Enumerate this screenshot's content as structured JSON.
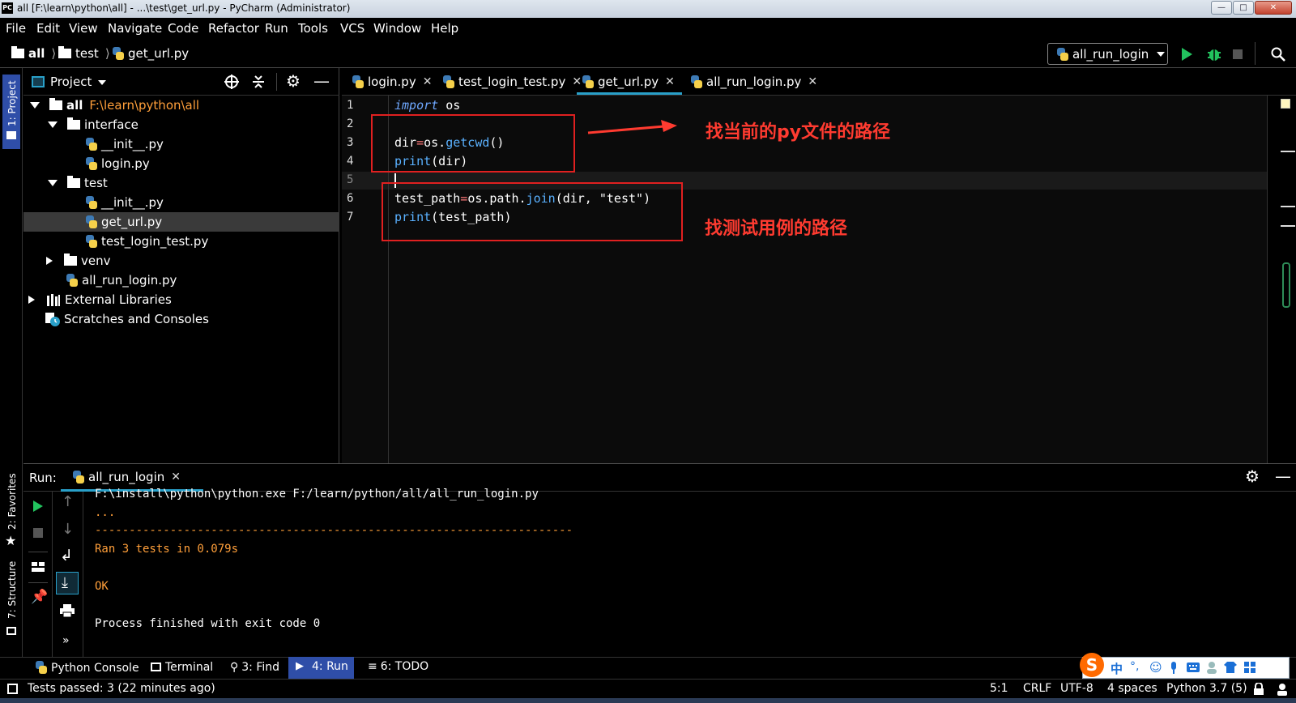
{
  "window": {
    "title": "all [F:\\learn\\python\\all] - ...\\test\\get_url.py - PyCharm (Administrator)",
    "logo": "PC"
  },
  "menu": [
    "File",
    "Edit",
    "View",
    "Navigate",
    "Code",
    "Refactor",
    "Run",
    "Tools",
    "VCS",
    "Window",
    "Help"
  ],
  "breadcrumb": [
    "all",
    "test",
    "get_url.py"
  ],
  "run_config": "all_run_login",
  "left_strip": {
    "project": "1: Project",
    "favorites": "2: Favorites",
    "structure": "7: Structure"
  },
  "project_panel": {
    "title": "Project",
    "tree": [
      {
        "label": "all",
        "extra": "F:\\learn\\python\\all",
        "type": "folder",
        "expanded": true
      },
      {
        "label": "interface",
        "type": "folder",
        "expanded": true
      },
      {
        "label": "__init__.py",
        "type": "py"
      },
      {
        "label": "login.py",
        "type": "py"
      },
      {
        "label": "test",
        "type": "folder",
        "expanded": true
      },
      {
        "label": "__init__.py",
        "type": "py"
      },
      {
        "label": "get_url.py",
        "type": "py",
        "selected": true
      },
      {
        "label": "test_login_test.py",
        "type": "py"
      },
      {
        "label": "venv",
        "type": "folder",
        "expanded": false
      },
      {
        "label": "all_run_login.py",
        "type": "py"
      },
      {
        "label": "External Libraries",
        "type": "lib",
        "expanded": false
      },
      {
        "label": "Scratches and Consoles",
        "type": "scratch"
      }
    ]
  },
  "editor": {
    "tabs": [
      "login.py",
      "test_login_test.py",
      "get_url.py",
      "all_run_login.py"
    ],
    "active_tab": "get_url.py",
    "line_numbers": [
      "1",
      "2",
      "3",
      "4",
      "5",
      "6",
      "7"
    ],
    "code": {
      "l1_kw": "import",
      "l1_rest": " os",
      "l3_a": "dir",
      "l3_op": "=",
      "l3_b": "os.",
      "l3_fn": "getcwd",
      "l3_c": "()",
      "l4_fn": "print",
      "l4_rest": "(dir)",
      "l6_a": "test_path",
      "l6_op": "=",
      "l6_b": "os.path.",
      "l6_fn": "join",
      "l6_c": "(dir, ",
      "l6_str": "\"test\"",
      "l6_d": ")",
      "l7_fn": "print",
      "l7_rest": "(test_path)"
    },
    "annotations": {
      "a1": "找当前的py文件的路径",
      "a2": "找测试用例的路径"
    }
  },
  "run_panel": {
    "label": "Run:",
    "tab": "all_run_login",
    "output": [
      "F:\\install\\python\\python.exe F:/learn/python/all/all_run_login.py",
      "...",
      "----------------------------------------------------------------------",
      "Ran 3 tests in 0.079s",
      "",
      "OK",
      "",
      "Process finished with exit code 0"
    ]
  },
  "tool_windows": [
    {
      "label": "Python Console"
    },
    {
      "label": "Terminal"
    },
    {
      "label": "3: Find"
    },
    {
      "label": "4: Run"
    },
    {
      "label": "6: TODO"
    }
  ],
  "ime": {
    "lang": "中",
    "punct": "°,"
  },
  "status": {
    "message": "Tests passed: 3 (22 minutes ago)",
    "position": "5:1",
    "line_sep": "CRLF",
    "encoding": "UTF-8",
    "indent": "4 spaces",
    "interpreter": "Python 3.7 (5)"
  },
  "colors": {
    "accent_tab": "#29a0c9",
    "annotation": "#ff3b30",
    "run_green": "#22c35e",
    "keyword": "#6fa8ff",
    "output_orange": "#ff9f3a"
  }
}
